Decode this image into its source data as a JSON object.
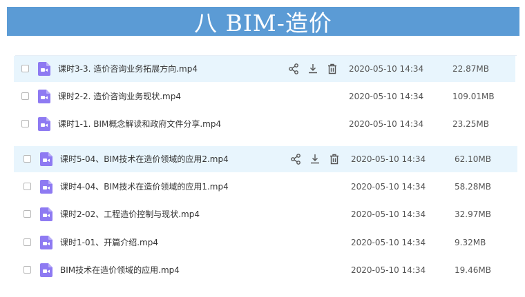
{
  "banner": {
    "title": "八 BIM-造价"
  },
  "icons": {
    "file": "video-file-icon",
    "share": "share-icon",
    "download": "download-icon",
    "delete": "trash-icon"
  },
  "colors": {
    "banner": "#5b9bd5",
    "file_icon": "#8e7af2",
    "highlight_row": "#e8f5fd"
  },
  "group1": {
    "files": [
      {
        "name": "课时3-3. 造价咨询业务拓展方向.mp4",
        "date": "2020-05-10 14:34",
        "size": "22.87MB",
        "highlighted": true
      },
      {
        "name": "课时2-2. 造价咨询业务现状.mp4",
        "date": "2020-05-10 14:34",
        "size": "109.01MB",
        "highlighted": false
      },
      {
        "name": "课时1-1. BIM概念解读和政府文件分享.mp4",
        "date": "2020-05-10 14:34",
        "size": "23.25MB",
        "highlighted": false
      }
    ]
  },
  "group2": {
    "files": [
      {
        "name": "课时5-04、BIM技术在造价领域的应用2.mp4",
        "date": "2020-05-10 14:34",
        "size": "62.10MB",
        "highlighted": true
      },
      {
        "name": "课时4-04、BIM技术在造价领域的应用1.mp4",
        "date": "2020-05-10 14:34",
        "size": "58.28MB",
        "highlighted": false
      },
      {
        "name": "课时2-02、工程造价控制与现状.mp4",
        "date": "2020-05-10 14:34",
        "size": "32.97MB",
        "highlighted": false
      },
      {
        "name": "课时1-01、开篇介绍.mp4",
        "date": "2020-05-10 14:34",
        "size": "9.32MB",
        "highlighted": false
      },
      {
        "name": "BIM技术在造价领域的应用.mp4",
        "date": "2020-05-10 14:34",
        "size": "19.46MB",
        "highlighted": false
      }
    ]
  }
}
